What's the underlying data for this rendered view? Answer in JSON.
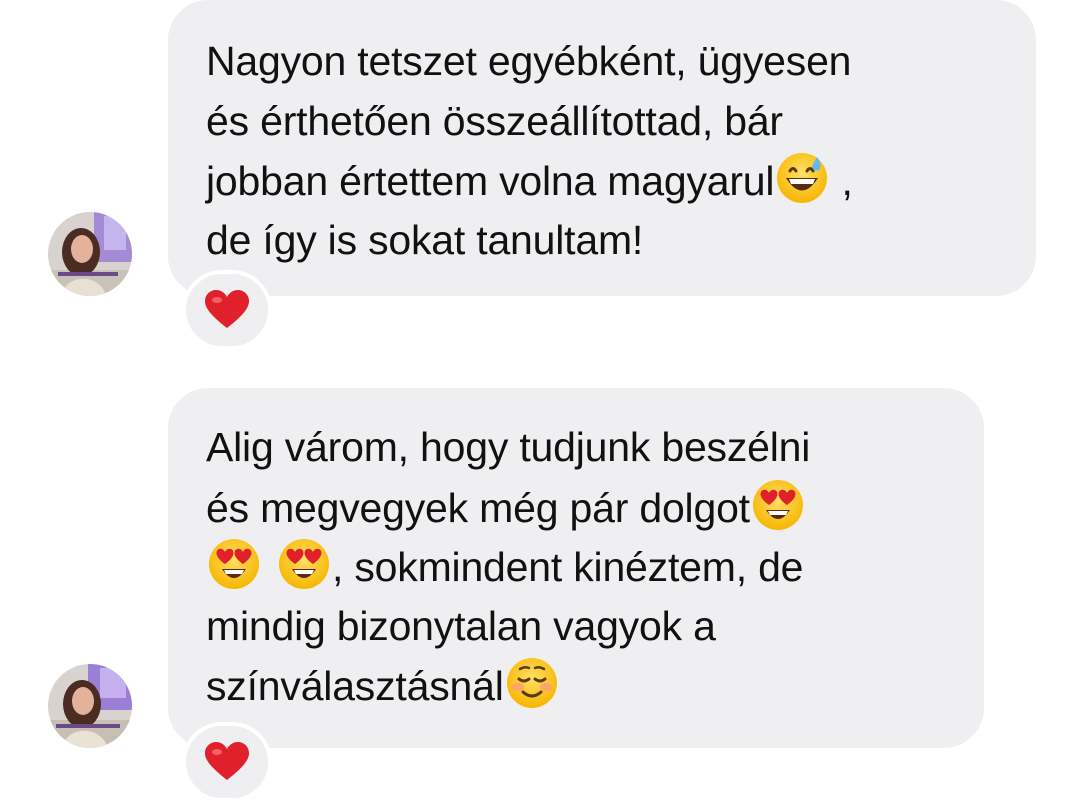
{
  "messages": [
    {
      "lines": [
        {
          "before": "Nagyon tetszet egyébként, ügyesen",
          "emoji": null,
          "after": ""
        },
        {
          "before": "és érthetően összeállítottad, bár",
          "emoji": null,
          "after": ""
        },
        {
          "before": "jobban értettem volna magyarul",
          "emoji": "grinning-sweat-emoji",
          "after": " ,"
        },
        {
          "before": "de így is sokat tanultam!",
          "emoji": null,
          "after": ""
        }
      ],
      "reaction": "red-heart-emoji"
    },
    {
      "lines": [
        {
          "before": "Alig várom, hogy tudjunk beszélni",
          "emoji": null,
          "after": ""
        },
        {
          "before": "és megvegyek még pár dolgot",
          "emoji": "heart-eyes-emoji",
          "after": ""
        },
        {
          "before": "",
          "emoji": "heart-eyes-emoji",
          "after": ", sokmindent kinéztem, de"
        },
        {
          "before": "mindig bizonytalan vagyok a",
          "emoji": null,
          "after": ""
        },
        {
          "before": "színválasztásnál",
          "emoji": "smiling-face-emoji",
          "after": ""
        }
      ],
      "reaction": "red-heart-emoji"
    }
  ],
  "colors": {
    "bubble": "#efeff1",
    "text": "#111111",
    "heart": "#e0202a",
    "background": "#ffffff"
  }
}
